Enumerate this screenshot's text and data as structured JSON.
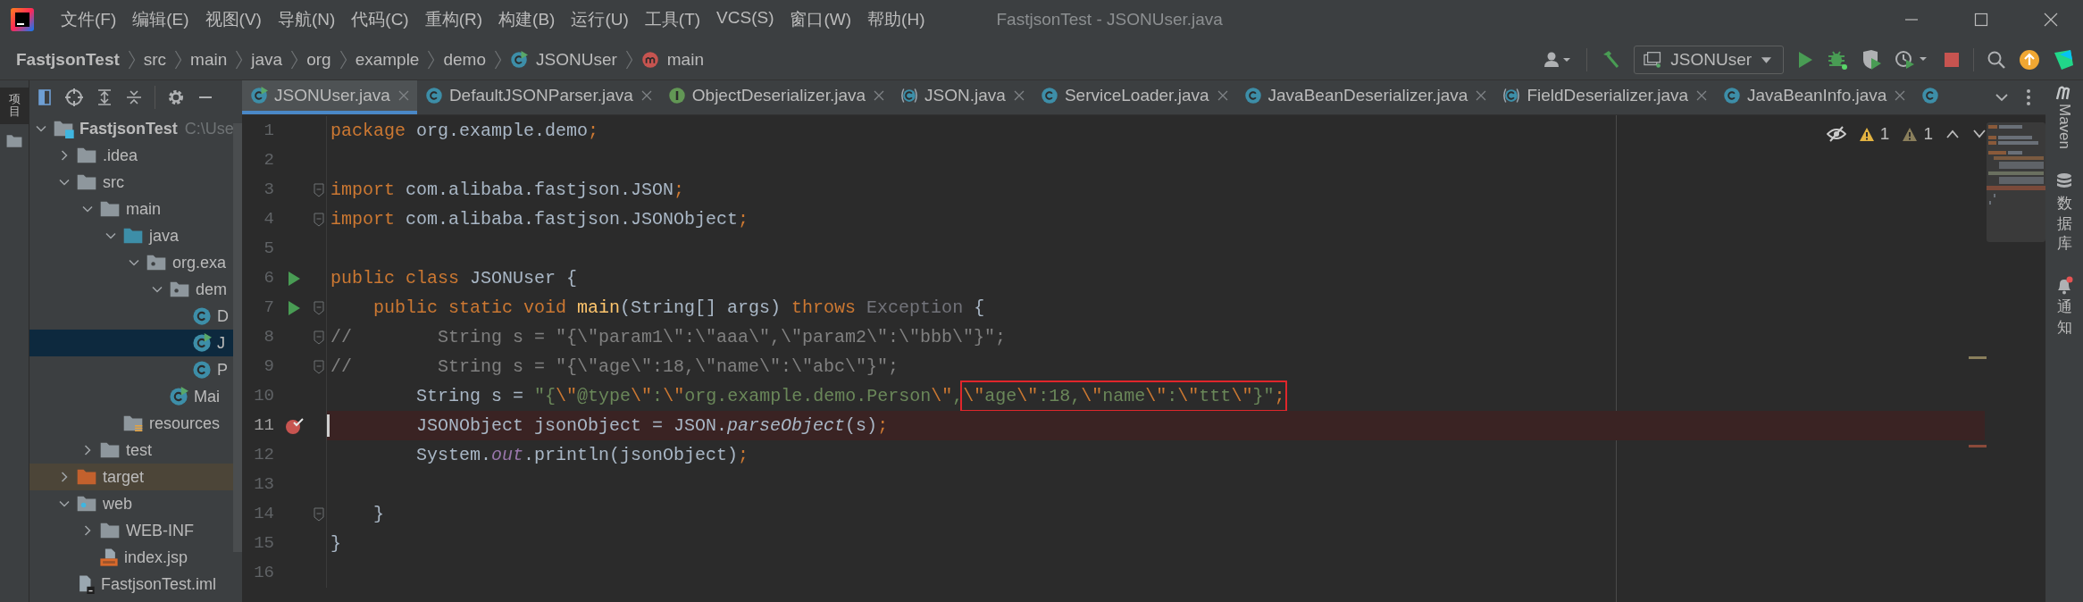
{
  "window": {
    "title": "FastjsonTest - JSONUser.java"
  },
  "menu": [
    "文件(F)",
    "编辑(E)",
    "视图(V)",
    "导航(N)",
    "代码(C)",
    "重构(R)",
    "构建(B)",
    "运行(U)",
    "工具(T)",
    "VCS(S)",
    "窗口(W)",
    "帮助(H)"
  ],
  "breadcrumb": [
    {
      "label": "FastjsonTest",
      "kind": "project"
    },
    {
      "label": "src",
      "kind": "directory"
    },
    {
      "label": "main",
      "kind": "directory"
    },
    {
      "label": "java",
      "kind": "directory"
    },
    {
      "label": "org",
      "kind": "directory"
    },
    {
      "label": "example",
      "kind": "directory"
    },
    {
      "label": "demo",
      "kind": "directory"
    },
    {
      "label": "JSONUser",
      "kind": "class-run"
    },
    {
      "label": "main",
      "kind": "method"
    }
  ],
  "run_config": {
    "label": "JSONUser"
  },
  "left_tool_window": {
    "label": "项目"
  },
  "project_tree": [
    {
      "label": "FastjsonTest",
      "path": "C:\\Use",
      "kind": "module",
      "expanded": true,
      "selected": false,
      "children": [
        {
          "label": ".idea",
          "kind": "folder",
          "expanded": false,
          "selected": false
        },
        {
          "label": "src",
          "kind": "folder",
          "expanded": true,
          "selected": false,
          "children": [
            {
              "label": "main",
              "kind": "folder",
              "expanded": true,
              "selected": false,
              "children": [
                {
                  "label": "java",
                  "kind": "source-folder",
                  "expanded": true,
                  "selected": false,
                  "children": [
                    {
                      "label": "org.exa",
                      "kind": "package",
                      "expanded": true,
                      "selected": false,
                      "children": [
                        {
                          "label": "dem",
                          "kind": "package",
                          "expanded": true,
                          "selected": false,
                          "children": [
                            {
                              "label": "D",
                              "kind": "class",
                              "selected": false
                            },
                            {
                              "label": "J",
                              "kind": "class-run",
                              "selected": true
                            },
                            {
                              "label": "P",
                              "kind": "class",
                              "selected": false
                            }
                          ]
                        },
                        {
                          "label": "Mai",
                          "kind": "class-run",
                          "selected": false
                        }
                      ]
                    }
                  ]
                },
                {
                  "label": "resources",
                  "kind": "resources",
                  "selected": false
                }
              ]
            },
            {
              "label": "test",
              "kind": "folder",
              "expanded": false,
              "selected": false
            }
          ]
        },
        {
          "label": "target",
          "kind": "excluded-folder",
          "expanded": false,
          "selected": false
        },
        {
          "label": "web",
          "kind": "web-folder",
          "expanded": true,
          "selected": false,
          "children": [
            {
              "label": "WEB-INF",
              "kind": "folder",
              "expanded": false,
              "selected": false
            },
            {
              "label": "index.jsp",
              "kind": "jsp",
              "selected": false
            }
          ]
        },
        {
          "label": "FastjsonTest.iml",
          "kind": "iml",
          "selected": false
        }
      ]
    }
  ],
  "tabs": [
    {
      "label": "JSONUser.java",
      "kind": "class-run",
      "selected": true
    },
    {
      "label": "DefaultJSONParser.java",
      "kind": "class",
      "selected": false
    },
    {
      "label": "ObjectDeserializer.java",
      "kind": "interface",
      "selected": false
    },
    {
      "label": "JSON.java",
      "kind": "class-bracket",
      "selected": false
    },
    {
      "label": "ServiceLoader.java",
      "kind": "class",
      "selected": false
    },
    {
      "label": "JavaBeanDeserializer.java",
      "kind": "class",
      "selected": false
    },
    {
      "label": "FieldDeserializer.java",
      "kind": "class-bracket",
      "selected": false
    },
    {
      "label": "JavaBeanInfo.java",
      "kind": "class",
      "selected": false
    },
    {
      "kind": "class",
      "selected": false
    }
  ],
  "inspections": [
    {
      "kind": "warning",
      "count": "1"
    },
    {
      "kind": "weak-warning",
      "count": "1"
    }
  ],
  "code_lines": [
    {
      "number": "1",
      "run": false,
      "breakpoint": false,
      "fold": false,
      "tokens": [
        {
          "kind": "kw",
          "text": "package "
        },
        {
          "kind": "txt",
          "text": "org.example.demo"
        },
        {
          "kind": "kw",
          "text": ";"
        }
      ]
    },
    {
      "number": "2",
      "run": false,
      "breakpoint": false,
      "fold": false
    },
    {
      "number": "3",
      "run": false,
      "breakpoint": false,
      "fold": true,
      "tokens": [
        {
          "kind": "kw",
          "text": "import "
        },
        {
          "kind": "txt",
          "text": "com.alibaba.fastjson.JSON"
        },
        {
          "kind": "kw",
          "text": ";"
        }
      ]
    },
    {
      "number": "4",
      "run": false,
      "breakpoint": false,
      "fold": true,
      "tokens": [
        {
          "kind": "kw",
          "text": "import "
        },
        {
          "kind": "txt",
          "text": "com.alibaba.fastjson.JSONObject"
        },
        {
          "kind": "kw",
          "text": ";"
        }
      ]
    },
    {
      "number": "5",
      "run": false,
      "breakpoint": false,
      "fold": false
    },
    {
      "number": "6",
      "run": true,
      "breakpoint": false,
      "fold": false,
      "tokens": [
        {
          "kind": "kw",
          "text": "public class "
        },
        {
          "kind": "txt",
          "text": "JSONUser {"
        }
      ]
    },
    {
      "number": "7",
      "run": true,
      "breakpoint": false,
      "fold": true,
      "tokens": [
        {
          "kind": "kw",
          "text": "    public static void "
        },
        {
          "kind": "fn",
          "text": "main"
        },
        {
          "kind": "txt",
          "text": "(String[] args) "
        },
        {
          "kind": "kw",
          "text": "throws "
        },
        {
          "kind": "unused",
          "text": "Exception"
        },
        {
          "kind": "txt",
          "text": " {"
        }
      ]
    },
    {
      "number": "8",
      "run": false,
      "breakpoint": false,
      "fold": true,
      "tokens": [
        {
          "kind": "cmt",
          "text": "//        String s = \"{\\\"param1\\\":\\\"aaa\\\",\\\"param2\\\":\\\"bbb\\\"}\";"
        }
      ]
    },
    {
      "number": "9",
      "run": false,
      "breakpoint": false,
      "fold": true,
      "tokens": [
        {
          "kind": "cmt",
          "text": "//        String s = \"{\\\"age\\\":18,\\\"name\\\":\\\"abc\\\"}\";"
        }
      ]
    },
    {
      "number": "10",
      "run": false,
      "breakpoint": false,
      "fold": false,
      "tokens": [
        {
          "kind": "txt",
          "text": "        String s = "
        },
        {
          "kind": "str",
          "text": "\"{"
        },
        {
          "kind": "esc",
          "text": "\\\""
        },
        {
          "kind": "str",
          "text": "@type"
        },
        {
          "kind": "esc",
          "text": "\\\""
        },
        {
          "kind": "str",
          "text": ":"
        },
        {
          "kind": "esc",
          "text": "\\\""
        },
        {
          "kind": "str",
          "text": "org.example.demo.Person"
        },
        {
          "kind": "esc",
          "text": "\\\""
        },
        {
          "kind": "str",
          "text": ","
        }
      ],
      "boxed_tokens": [
        {
          "kind": "esc",
          "text": "\\\""
        },
        {
          "kind": "str",
          "text": "age"
        },
        {
          "kind": "esc",
          "text": "\\\""
        },
        {
          "kind": "str",
          "text": ":18,"
        },
        {
          "kind": "esc",
          "text": "\\\""
        },
        {
          "kind": "str",
          "text": "name"
        },
        {
          "kind": "esc",
          "text": "\\\""
        },
        {
          "kind": "str",
          "text": ":"
        },
        {
          "kind": "esc",
          "text": "\\\""
        },
        {
          "kind": "str",
          "text": "ttt"
        },
        {
          "kind": "esc",
          "text": "\\\""
        },
        {
          "kind": "str",
          "text": "}\""
        },
        {
          "kind": "kw",
          "text": ";"
        }
      ]
    },
    {
      "number": "11",
      "run": false,
      "breakpoint": true,
      "fold": false,
      "tokens": [
        {
          "kind": "txt",
          "text": "        JSONObject jsonObject = JSON."
        },
        {
          "kind": "italic",
          "text": "parseObject"
        },
        {
          "kind": "txt",
          "text": "(s)"
        },
        {
          "kind": "kw",
          "text": ";"
        }
      ]
    },
    {
      "number": "12",
      "run": false,
      "breakpoint": false,
      "fold": false,
      "tokens": [
        {
          "kind": "txt",
          "text": "        System."
        },
        {
          "kind": "field",
          "text": "out"
        },
        {
          "kind": "txt",
          "text": ".println(jsonObject)"
        },
        {
          "kind": "kw",
          "text": ";"
        }
      ]
    },
    {
      "number": "13",
      "run": false,
      "breakpoint": false,
      "fold": false
    },
    {
      "number": "14",
      "run": false,
      "breakpoint": false,
      "fold": true,
      "tokens": [
        {
          "kind": "txt",
          "text": "    }"
        }
      ]
    },
    {
      "number": "15",
      "run": false,
      "breakpoint": false,
      "fold": false,
      "tokens": [
        {
          "kind": "txt",
          "text": "}"
        }
      ]
    },
    {
      "number": "16",
      "run": false,
      "breakpoint": false,
      "fold": false
    }
  ],
  "right_tool_windows": [
    {
      "kind": "maven",
      "label": "Maven"
    },
    {
      "kind": "database",
      "label": "数据库"
    },
    {
      "kind": "notifications",
      "label": "通知"
    }
  ]
}
